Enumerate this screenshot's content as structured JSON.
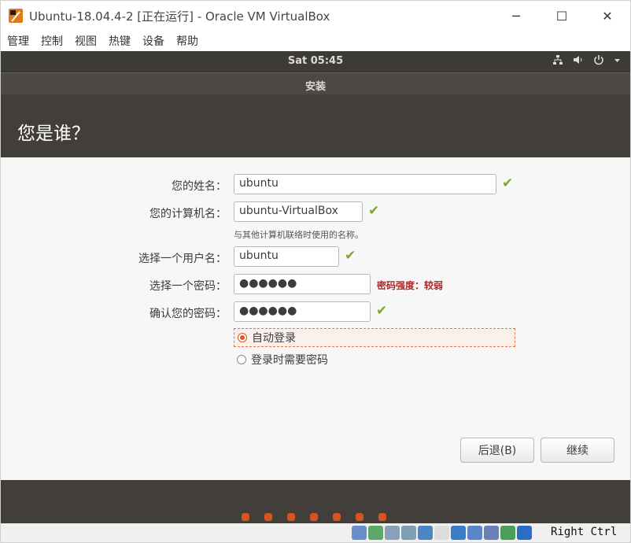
{
  "window": {
    "title": "Ubuntu-18.04.4-2 [正在运行] - Oracle VM VirtualBox",
    "controls": {
      "minimize": "─",
      "maximize": "☐",
      "close": "✕"
    }
  },
  "menubar": {
    "items": [
      "管理",
      "控制",
      "视图",
      "热键",
      "设备",
      "帮助"
    ]
  },
  "guest_topbar": {
    "clock": "Sat 05:45",
    "icons": [
      "network-icon",
      "volume-icon",
      "power-icon",
      "chevron-down-icon"
    ]
  },
  "installer": {
    "title": "安装",
    "heading": "您是谁？",
    "fields": [
      {
        "label": "您的姓名：",
        "value": "ubuntu"
      },
      {
        "label": "您的计算机名：",
        "value": "ubuntu-VirtualBox",
        "hint": "与其他计算机联络时使用的名称。"
      },
      {
        "label": "选择一个用户名：",
        "value": "ubuntu"
      },
      {
        "label": "选择一个密码：",
        "value": "●●●●●●",
        "strength": "密码强度：较弱"
      },
      {
        "label": "确认您的密码：",
        "value": "●●●●●●"
      }
    ],
    "login_options": [
      {
        "label": "自动登录",
        "selected": true
      },
      {
        "label": "登录时需要密码",
        "selected": false
      }
    ],
    "buttons": {
      "back": "后退(B)",
      "continue": "继续"
    },
    "progress_dots": 7
  },
  "statusbar": {
    "host_key": "Right Ctrl"
  },
  "colors": {
    "accent": "#e95420",
    "check": "#7fa82b",
    "header_bg": "#423f3a"
  }
}
